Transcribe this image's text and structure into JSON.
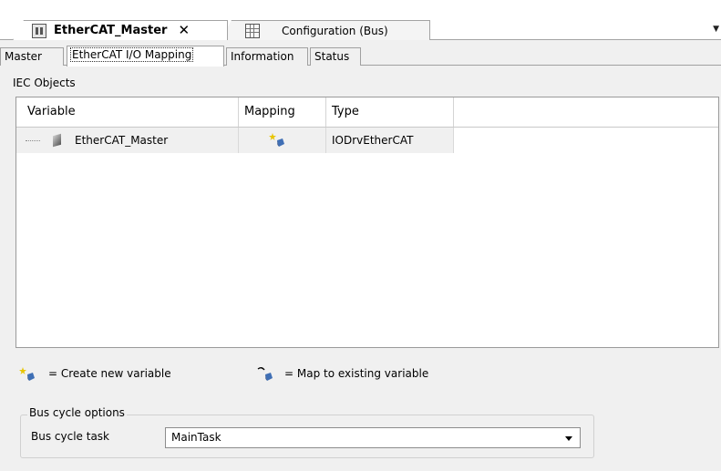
{
  "editor_tabs": [
    {
      "label": "EtherCAT_Master",
      "icon": "device-icon",
      "active": true,
      "close_glyph": "✕"
    },
    {
      "label": "Configuration (Bus)",
      "icon": "table-icon",
      "active": false
    }
  ],
  "overflow_glyph": "▼",
  "inner_tabs": [
    {
      "label": "Master"
    },
    {
      "label": "EtherCAT I/O Mapping",
      "selected": true
    },
    {
      "label": "Information"
    },
    {
      "label": "Status"
    }
  ],
  "iec_objects": {
    "title": "IEC Objects",
    "columns": [
      "Variable",
      "Mapping",
      "Type"
    ],
    "rows": [
      {
        "variable": "EtherCAT_Master",
        "mapping_icon": "create-new-variable-icon",
        "type": "IODrvEtherCAT"
      }
    ]
  },
  "legend": {
    "create_new": "= Create new variable",
    "map_existing": "= Map to existing variable"
  },
  "bus_cycle": {
    "group_title": "Bus cycle options",
    "label": "Bus cycle task",
    "value": "MainTask"
  },
  "colors": {
    "panel_background": "#f0f0f0",
    "border": "#a0a0a0",
    "icon_accent": "#e8c500",
    "icon_blue": "#3f6fb5"
  }
}
